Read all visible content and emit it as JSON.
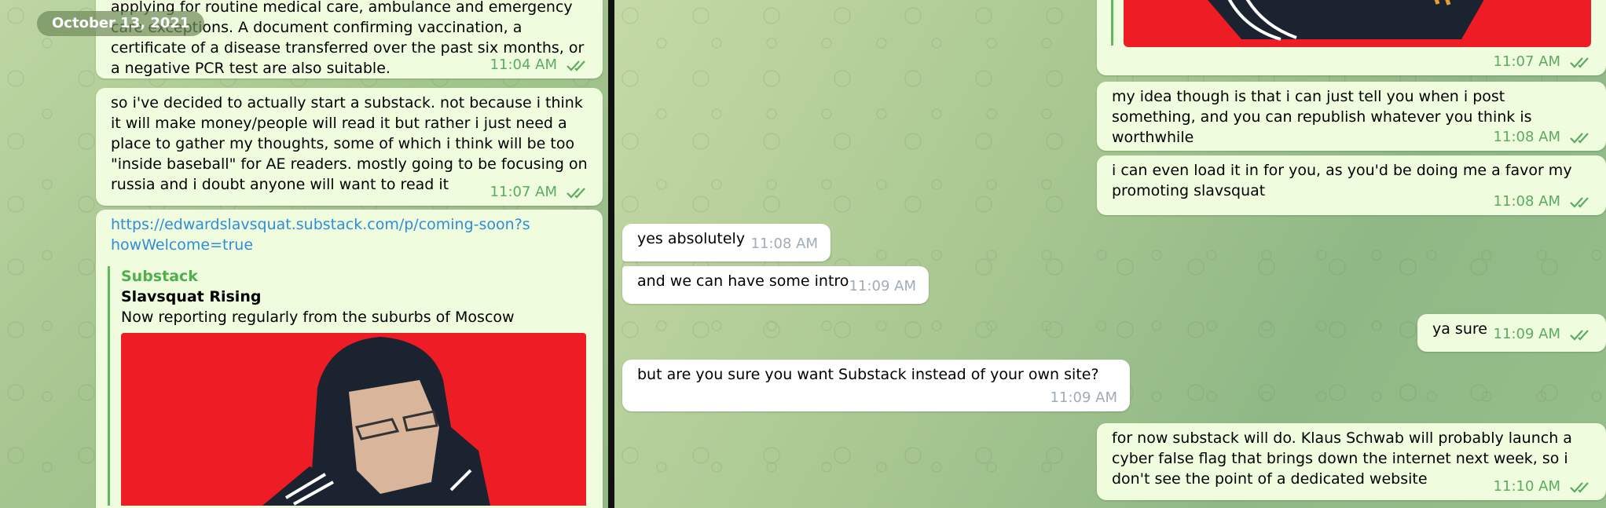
{
  "date_badge": "October 13, 2021",
  "left_messages": [
    {
      "text": "applying for routine medical care, ambulance and emergency care exceptions. A document confirming vaccination, a certificate of a disease transferred over the past six months, or a negative PCR test are also suitable.",
      "time": "11:04 AM"
    },
    {
      "text": "so i've decided to actually start a substack. not because i think it will make money/people will read it but rather i just need a place to gather my thoughts, some of which i think will be too \"inside baseball\" for AE readers. mostly going to be focusing on russia and i doubt anyone will want to read it",
      "time": "11:07 AM"
    },
    {
      "link": "https://edwardslavsquat.substack.com/p/coming-soon?showWelcome=true",
      "preview": {
        "site": "Substack",
        "title": "Slavsquat Rising",
        "description": "Now reporting regularly from the suburbs of Moscow"
      }
    }
  ],
  "right_messages": [
    {
      "side": "out",
      "text": "",
      "time": "11:07 AM"
    },
    {
      "side": "out",
      "text": "my idea though is that i can just tell you when i post something, and you can republish whatever you think is worthwhile",
      "time": "11:08 AM"
    },
    {
      "side": "out",
      "text": "i can even load it in for you, as you'd be doing me a favor my promoting slavsquat",
      "time": "11:08 AM"
    },
    {
      "side": "in",
      "text": "yes absolutely",
      "time": "11:08 AM"
    },
    {
      "side": "in",
      "text": "and we can have some intro",
      "time": "11:09 AM"
    },
    {
      "side": "out",
      "text": "ya sure",
      "time": "11:09 AM"
    },
    {
      "side": "in",
      "text": "but are you sure you want Substack instead of your own site?",
      "time": "11:09 AM"
    },
    {
      "side": "out",
      "text": "for now substack will do. Klaus Schwab will probably launch a cyber false flag that brings down the internet next week, so i don't see the point of a dedicated website",
      "time": "11:10 AM"
    }
  ],
  "icons": {
    "read_receipt": "double-check-icon"
  },
  "colors": {
    "outgoing": "#effdde",
    "incoming": "#ffffff",
    "accent": "#5bab61",
    "link": "#2f8dd6",
    "preview_red": "#ee1c25"
  }
}
